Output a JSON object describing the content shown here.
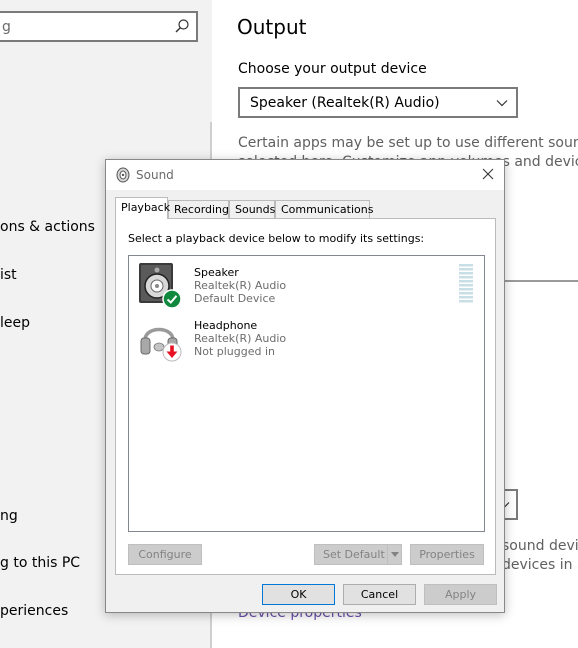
{
  "settings": {
    "search": {
      "value": "g"
    },
    "sidebar": {
      "items": [
        {
          "label": "ons & actions"
        },
        {
          "label": "ist"
        },
        {
          "label": "leep"
        },
        {
          "label": "ng"
        },
        {
          "label": "g to this PC"
        },
        {
          "label": "periences"
        }
      ]
    },
    "main": {
      "title": "Output",
      "choose_label": "Choose your output device",
      "selected_device": "Speaker (Realtek(R) Audio)",
      "description_line1": "Certain apps may be set up to use different sound devic",
      "description_line2": "selected here. Customize app volumes and devices in ad",
      "description2_line1": "sound devic",
      "description2_line2": "devices in ac",
      "device_properties_link": "Device properties"
    }
  },
  "dialog": {
    "title": "Sound",
    "tabs": [
      {
        "label": "Playback",
        "active": true
      },
      {
        "label": "Recording",
        "active": false
      },
      {
        "label": "Sounds",
        "active": false
      },
      {
        "label": "Communications",
        "active": false
      }
    ],
    "instruction": "Select a playback device below to modify its settings:",
    "devices": [
      {
        "name": "Speaker",
        "driver": "Realtek(R) Audio",
        "status": "Default Device",
        "icon": "speaker-icon",
        "badge": "default-check-icon"
      },
      {
        "name": "Headphone",
        "driver": "Realtek(R) Audio",
        "status": "Not plugged in",
        "icon": "headphone-icon",
        "badge": "unplugged-arrow-icon"
      }
    ],
    "buttons": {
      "configure": "Configure",
      "set_default": "Set Default",
      "properties": "Properties",
      "ok": "OK",
      "cancel": "Cancel",
      "apply": "Apply"
    }
  },
  "colors": {
    "link": "#6a4fa8",
    "check_badge": "#10893e",
    "unplugged_badge": "#e81123",
    "focus": "#0078d7"
  }
}
